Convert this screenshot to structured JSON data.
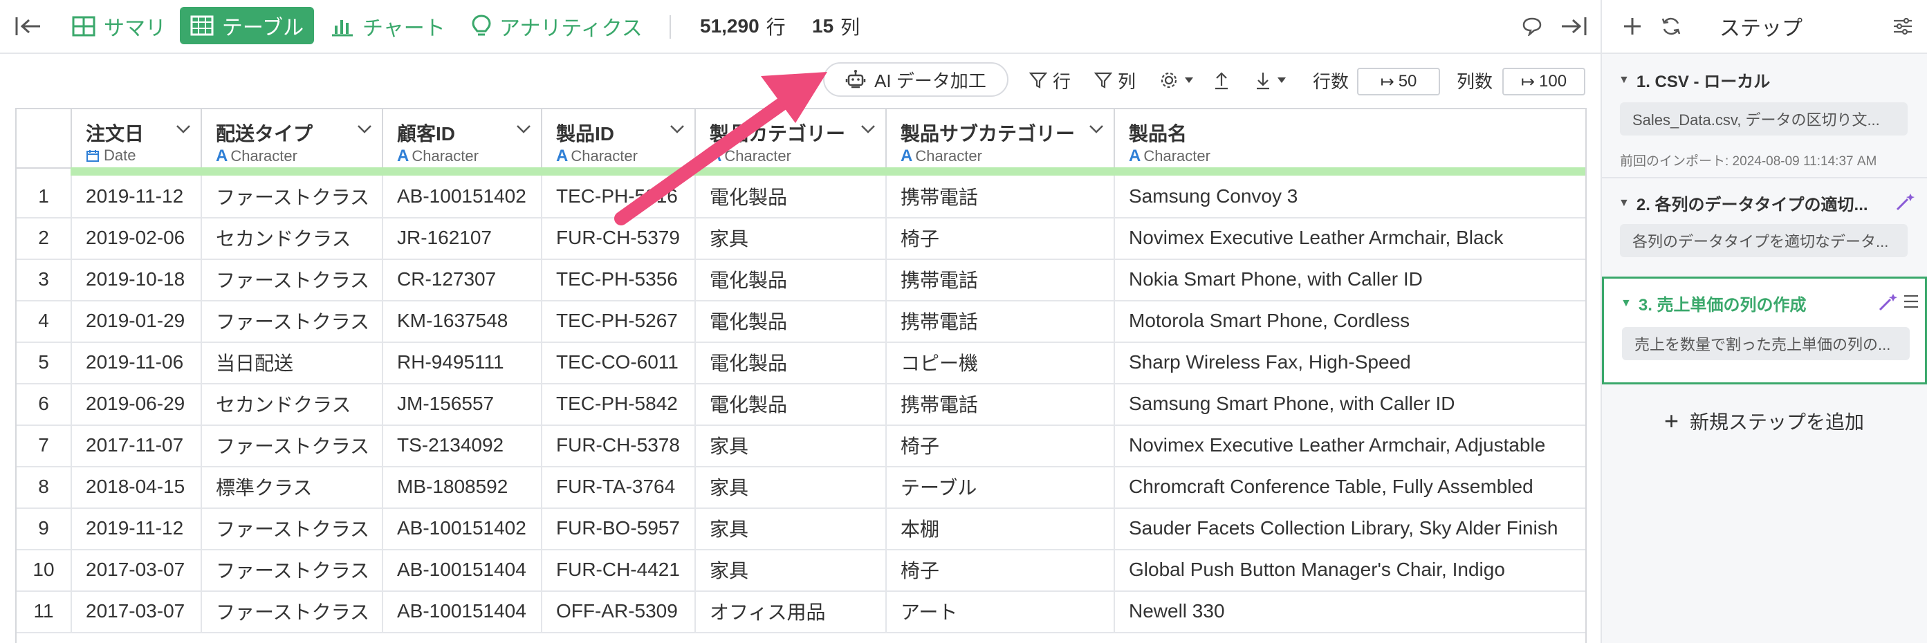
{
  "topbar": {
    "tabs": [
      {
        "label": "サマリ",
        "icon": "summary-grid-icon"
      },
      {
        "label": "テーブル",
        "icon": "table-icon",
        "active": true
      },
      {
        "label": "チャート",
        "icon": "bar-chart-icon"
      },
      {
        "label": "アナリティクス",
        "icon": "lightbulb-icon"
      }
    ],
    "rows_count": "51,290",
    "rows_unit": "行",
    "cols_count": "15",
    "cols_unit": "列"
  },
  "toolbar": {
    "ai_label": "AI データ加工",
    "filter_row": "行",
    "filter_col": "列",
    "rows_label": "行数",
    "rows_value": "50",
    "cols_label": "列数",
    "cols_value": "100"
  },
  "table": {
    "columns": [
      {
        "name": "注文日",
        "type": "Date"
      },
      {
        "name": "配送タイプ",
        "type": "Character"
      },
      {
        "name": "顧客ID",
        "type": "Character"
      },
      {
        "name": "製品ID",
        "type": "Character"
      },
      {
        "name": "製品カテゴリー",
        "type": "Character"
      },
      {
        "name": "製品サブカテゴリー",
        "type": "Character"
      },
      {
        "name": "製品名",
        "type": "Character"
      }
    ],
    "rows": [
      [
        "1",
        "2019-11-12",
        "ファーストクラス",
        "AB-100151402",
        "TEC-PH-5816",
        "電化製品",
        "携帯電話",
        "Samsung Convoy 3"
      ],
      [
        "2",
        "2019-02-06",
        "セカンドクラス",
        "JR-162107",
        "FUR-CH-5379",
        "家具",
        "椅子",
        "Novimex Executive Leather Armchair, Black"
      ],
      [
        "3",
        "2019-10-18",
        "ファーストクラス",
        "CR-127307",
        "TEC-PH-5356",
        "電化製品",
        "携帯電話",
        "Nokia Smart Phone, with Caller ID"
      ],
      [
        "4",
        "2019-01-29",
        "ファーストクラス",
        "KM-1637548",
        "TEC-PH-5267",
        "電化製品",
        "携帯電話",
        "Motorola Smart Phone, Cordless"
      ],
      [
        "5",
        "2019-11-06",
        "当日配送",
        "RH-9495111",
        "TEC-CO-6011",
        "電化製品",
        "コピー機",
        "Sharp Wireless Fax, High-Speed"
      ],
      [
        "6",
        "2019-06-29",
        "セカンドクラス",
        "JM-156557",
        "TEC-PH-5842",
        "電化製品",
        "携帯電話",
        "Samsung Smart Phone, with Caller ID"
      ],
      [
        "7",
        "2017-11-07",
        "ファーストクラス",
        "TS-2134092",
        "FUR-CH-5378",
        "家具",
        "椅子",
        "Novimex Executive Leather Armchair, Adjustable"
      ],
      [
        "8",
        "2018-04-15",
        "標準クラス",
        "MB-1808592",
        "FUR-TA-3764",
        "家具",
        "テーブル",
        "Chromcraft Conference Table, Fully Assembled"
      ],
      [
        "9",
        "2019-11-12",
        "ファーストクラス",
        "AB-100151402",
        "FUR-BO-5957",
        "家具",
        "本棚",
        "Sauder Facets Collection Library, Sky Alder Finish"
      ],
      [
        "10",
        "2017-03-07",
        "ファーストクラス",
        "AB-100151404",
        "FUR-CH-4421",
        "家具",
        "椅子",
        "Global Push Button Manager's Chair, Indigo"
      ],
      [
        "11",
        "2017-03-07",
        "ファーストクラス",
        "AB-100151404",
        "OFF-AR-5309",
        "オフィス用品",
        "アート",
        "Newell 330"
      ]
    ]
  },
  "panel": {
    "title": "ステップ",
    "steps": [
      {
        "title": "1. CSV - ローカル",
        "desc": "Sales_Data.csv, データの区切り文...",
        "meta": "前回のインポート: 2024-08-09 11:14:37 AM"
      },
      {
        "title": "2. 各列のデータタイプの適切...",
        "desc": "各列のデータタイプを適切なデータ..."
      },
      {
        "title": "3. 売上単価の列の作成",
        "desc": "売上を数量で割った売上単価の列の..."
      }
    ],
    "add_step": "新規ステップを追加"
  },
  "colors": {
    "accent": "#3aa86b",
    "arrow": "#ee4a7a",
    "type_icon": "#2f7fd6",
    "magic_wand": "#8a5bd6"
  }
}
